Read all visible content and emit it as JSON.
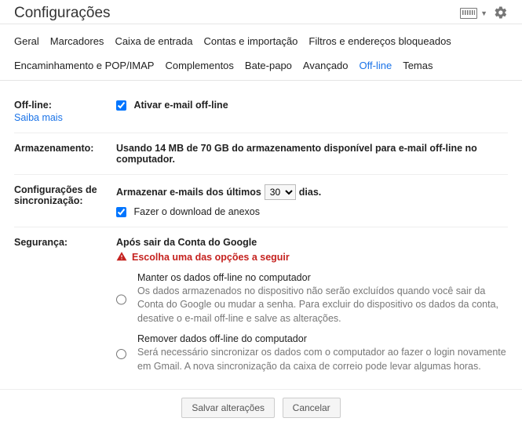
{
  "header": {
    "title": "Configurações"
  },
  "tabs": [
    "Geral",
    "Marcadores",
    "Caixa de entrada",
    "Contas e importação",
    "Filtros e endereços bloqueados",
    "Encaminhamento e POP/IMAP",
    "Complementos",
    "Bate-papo",
    "Avançado",
    "Off-line",
    "Temas"
  ],
  "active_tab": "Off-line",
  "offline": {
    "label": "Off-line:",
    "learn_more": "Saiba mais",
    "checkbox_label": "Ativar e-mail off-line"
  },
  "storage": {
    "label": "Armazenamento:",
    "text": "Usando 14 MB de 70 GB do armazenamento disponível para e-mail off-line no computador."
  },
  "sync": {
    "label": "Configurações de sincronização:",
    "prefix": "Armazenar e-mails dos últimos",
    "days_value": "30",
    "suffix": "dias.",
    "download_att": "Fazer o download de anexos"
  },
  "security": {
    "label": "Segurança:",
    "heading": "Após sair da Conta do Google",
    "warning": "Escolha uma das opções a seguir",
    "opt1_title": "Manter os dados off-line no computador",
    "opt1_desc": "Os dados armazenados no dispositivo não serão excluídos quando você sair da Conta do Google ou mudar a senha. Para excluir do dispositivo os dados da conta, desative o e-mail off-line e salve as alterações.",
    "opt2_title": "Remover dados off-line do computador",
    "opt2_desc": "Será necessário sincronizar os dados com o computador ao fazer o login novamente em Gmail. A nova sincronização da caixa de correio pode levar algumas horas."
  },
  "actions": {
    "save": "Salvar alterações",
    "cancel": "Cancelar"
  }
}
